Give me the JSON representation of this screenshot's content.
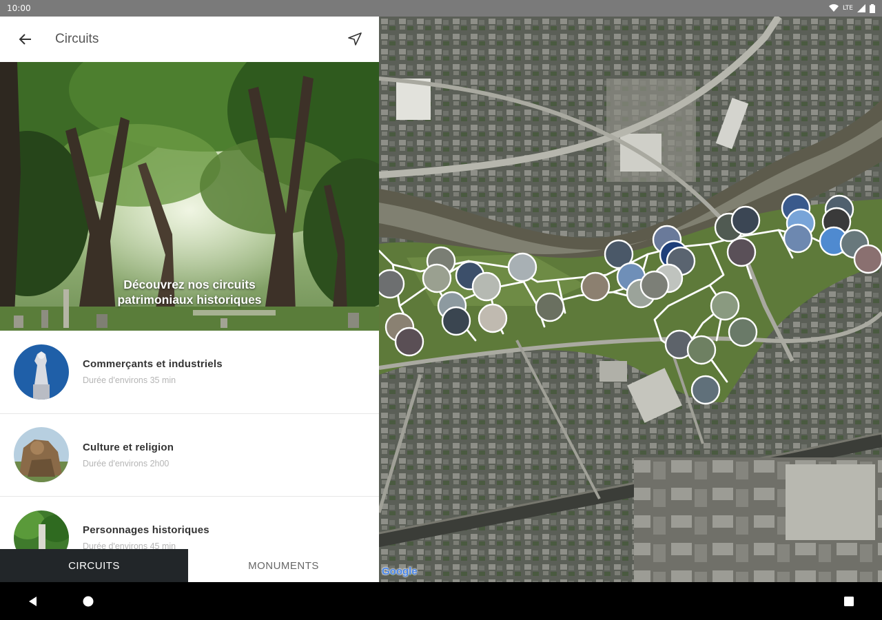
{
  "status_bar": {
    "time": "10:00",
    "network": "LTE"
  },
  "app_bar": {
    "title": "Circuits"
  },
  "hero": {
    "caption_line1": "Découvrez nos circuits",
    "caption_line2": "patrimoniaux historiques"
  },
  "circuits": [
    {
      "name": "Commerçants et industriels",
      "duration": "Durée d'environs 35 min",
      "thumb": "statue-blue"
    },
    {
      "name": "Culture et religion",
      "duration": "Durée d'environs 2h00",
      "thumb": "stone-figure"
    },
    {
      "name": "Personnages historiques",
      "duration": "Durée d'environs 45 min",
      "thumb": "monument-trees"
    }
  ],
  "tabs": {
    "active": "CIRCUITS",
    "inactive": "MONUMENTS"
  },
  "map": {
    "attribution": "Google"
  },
  "colors": {
    "tab_active_bg": "#222629",
    "status_bar_bg": "#7a7a7a",
    "hero_green": "#3f6b2a"
  }
}
